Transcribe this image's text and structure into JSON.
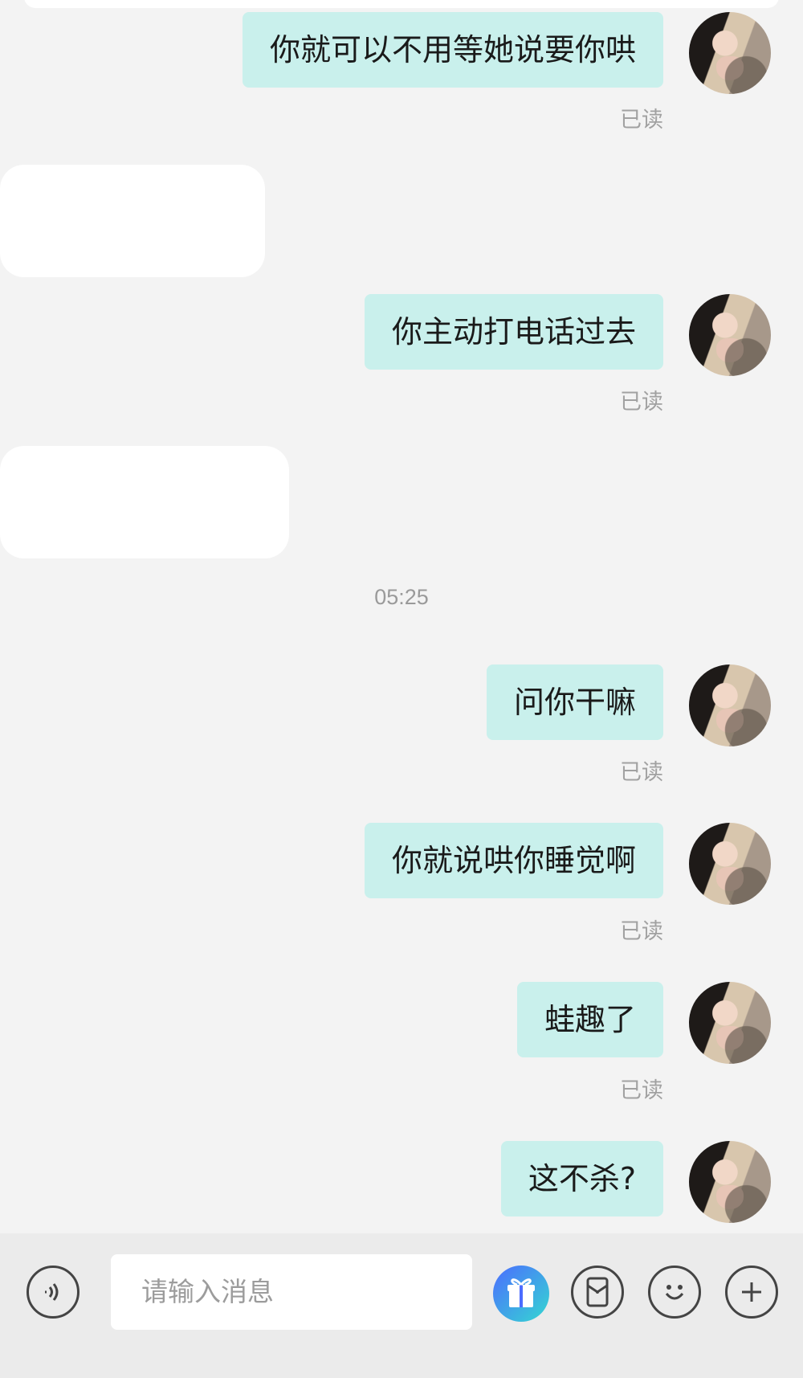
{
  "messages": [
    {
      "text": "你就可以不用等她说要你哄",
      "status": "已读"
    },
    {
      "text": "你主动打电话过去",
      "status": "已读"
    },
    {
      "text": "问你干嘛",
      "status": "已读"
    },
    {
      "text": "你就说哄你睡觉啊",
      "status": "已读"
    },
    {
      "text": "蛙趣了",
      "status": "已读"
    },
    {
      "text": "这不杀?"
    }
  ],
  "timestamp": "05:25",
  "input": {
    "placeholder": "请输入消息"
  },
  "icons": [
    "voice-icon",
    "gift-icon",
    "red-packet-icon",
    "emoji-icon",
    "plus-icon"
  ],
  "colors": {
    "bubble": "#c9f0ec",
    "background": "#f3f3f3",
    "gift_gradient_start": "#4c6cff",
    "gift_gradient_end": "#34d8d1"
  }
}
